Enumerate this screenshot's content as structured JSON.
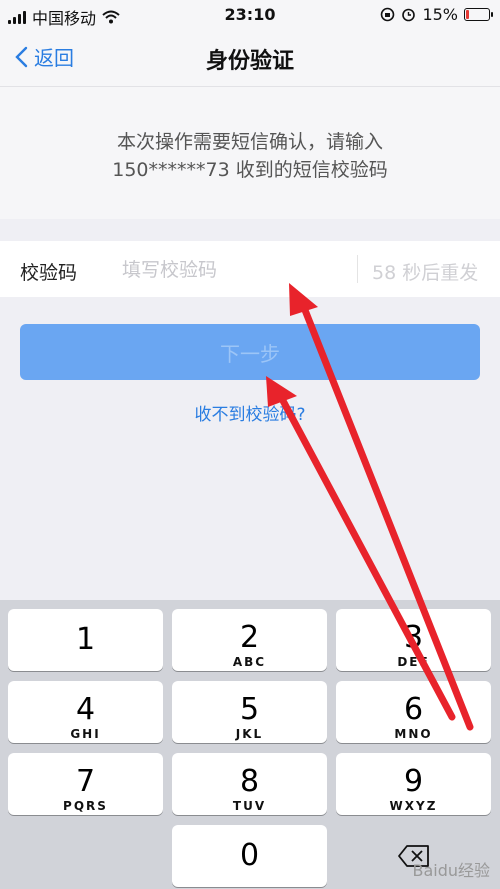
{
  "status": {
    "carrier": "中国移动",
    "time": "23:10",
    "battery": "15%",
    "battery_level": 0.15
  },
  "nav": {
    "back_label": "返回",
    "title": "身份验证"
  },
  "notice": {
    "line1": "本次操作需要短信确认，请输入",
    "line2": "150******73 收到的短信校验码"
  },
  "code": {
    "label": "校验码",
    "placeholder": "填写校验码",
    "resend": "58 秒后重发"
  },
  "next_button": "下一步",
  "no_code_link": "收不到校验码?",
  "keypad": {
    "k1": {
      "num": "1",
      "letters": ""
    },
    "k2": {
      "num": "2",
      "letters": "ABC"
    },
    "k3": {
      "num": "3",
      "letters": "DEF"
    },
    "k4": {
      "num": "4",
      "letters": "GHI"
    },
    "k5": {
      "num": "5",
      "letters": "JKL"
    },
    "k6": {
      "num": "6",
      "letters": "MNO"
    },
    "k7": {
      "num": "7",
      "letters": "PQRS"
    },
    "k8": {
      "num": "8",
      "letters": "TUV"
    },
    "k9": {
      "num": "9",
      "letters": "WXYZ"
    },
    "k0": {
      "num": "0",
      "letters": ""
    }
  },
  "watermark": "Baidu经验",
  "colors": {
    "accent": "#2a7de1",
    "button": "#6aa6f2",
    "arrow": "#e8232b"
  },
  "icons": {
    "back": "chevron-left-icon",
    "wifi": "wifi-icon",
    "delete": "backspace-icon"
  }
}
